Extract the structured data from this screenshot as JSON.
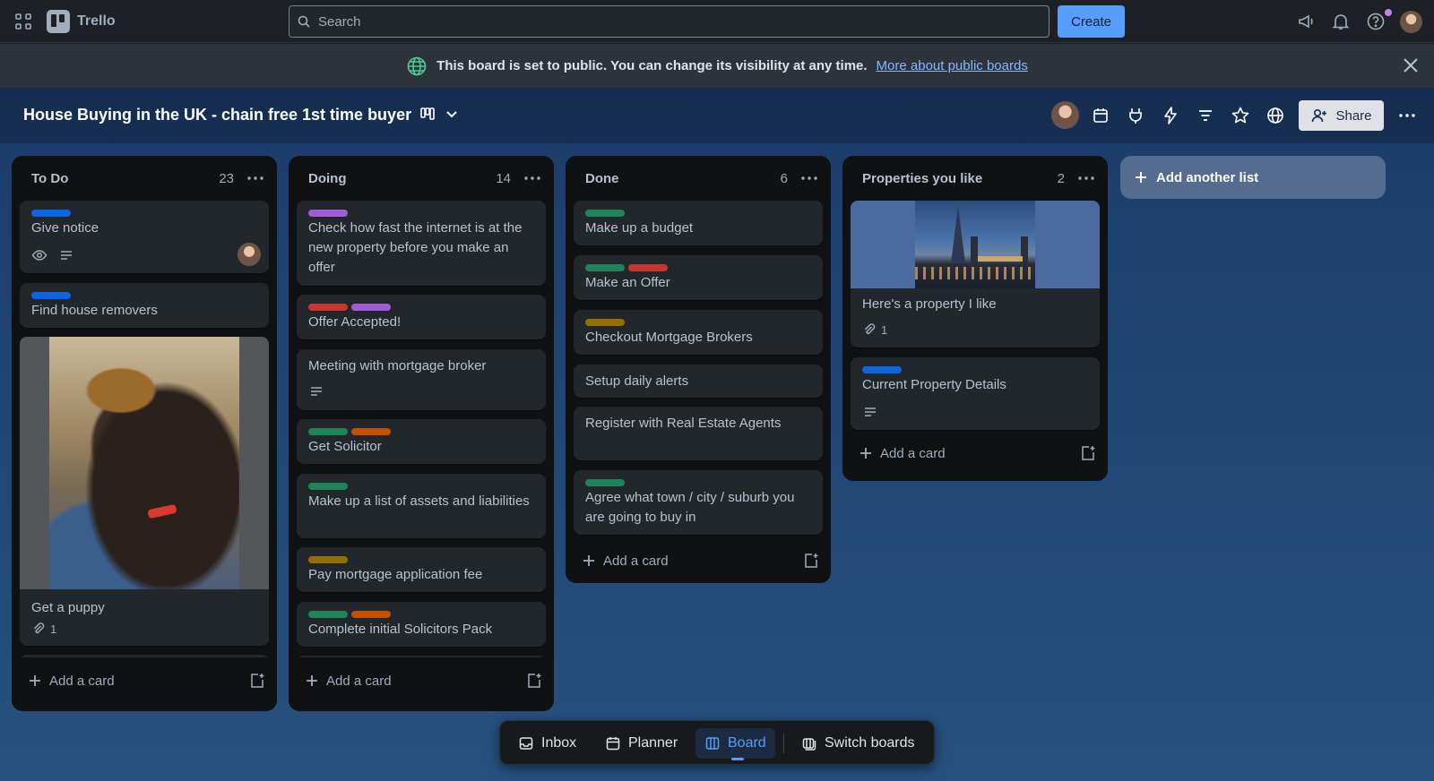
{
  "app": {
    "name": "Trello"
  },
  "topbar": {
    "search_placeholder": "Search",
    "create_label": "Create"
  },
  "banner": {
    "text": "This board is set to public. You can change its visibility at any time.",
    "link": "More about public boards"
  },
  "board": {
    "title": "House Buying in the UK - chain free 1st time buyer",
    "share_label": "Share"
  },
  "label_colors": {
    "blue": "#0c66e4",
    "purple": "#9f5cd4",
    "green": "#1f845a",
    "red": "#c9372c",
    "orange": "#c25100",
    "yellow": "#946f00"
  },
  "lists": [
    {
      "title": "To Do",
      "count": "23",
      "cards": [
        {
          "title": "Give notice",
          "labels": [
            "blue"
          ],
          "badges": [
            "eye",
            "description"
          ],
          "member": true
        },
        {
          "title": "Find house removers",
          "labels": [
            "blue"
          ]
        },
        {
          "title": "Get a puppy",
          "cover": "puppy",
          "attachments": "1"
        }
      ],
      "add_card": "Add a card"
    },
    {
      "title": "Doing",
      "count": "14",
      "cards": [
        {
          "title": "Check how fast the internet is at the new property before you make an offer",
          "labels": [
            "purple"
          ]
        },
        {
          "title": "Offer Accepted!",
          "labels": [
            "red",
            "purple"
          ]
        },
        {
          "title": "Meeting with mortgage broker",
          "badges": [
            "description"
          ]
        },
        {
          "title": "Get Solicitor",
          "labels": [
            "green",
            "orange"
          ]
        },
        {
          "title": "Make up a list of assets and liabilities",
          "labels": [
            "green"
          ]
        },
        {
          "title": "Pay mortgage application fee",
          "labels": [
            "yellow"
          ]
        },
        {
          "title": "Complete initial Solicitors Pack",
          "labels": [
            "green",
            "orange"
          ]
        }
      ],
      "add_card": "Add a card"
    },
    {
      "title": "Done",
      "count": "6",
      "cards": [
        {
          "title": "Make up a budget",
          "labels": [
            "green"
          ]
        },
        {
          "title": "Make an Offer",
          "labels": [
            "green",
            "red"
          ]
        },
        {
          "title": "Checkout Mortgage Brokers",
          "labels": [
            "yellow"
          ]
        },
        {
          "title": "Setup daily alerts"
        },
        {
          "title": "Register with Real Estate Agents"
        },
        {
          "title": "Agree what town / city / suburb you are going to buy in",
          "labels": [
            "green"
          ]
        }
      ],
      "add_card": "Add a card"
    },
    {
      "title": "Properties you like",
      "count": "2",
      "cards": [
        {
          "title": "Here's a property I like",
          "cover": "london",
          "attachments": "1"
        },
        {
          "title": "Current Property Details",
          "labels": [
            "blue"
          ],
          "badges": [
            "description"
          ]
        }
      ],
      "add_card": "Add a card"
    }
  ],
  "add_list": "Add another list",
  "bottom_nav": [
    {
      "label": "Inbox",
      "icon": "inbox-icon"
    },
    {
      "label": "Planner",
      "icon": "calendar-icon"
    },
    {
      "label": "Board",
      "icon": "board-icon",
      "active": true
    },
    {
      "label": "Switch boards",
      "icon": "switch-boards-icon"
    }
  ]
}
